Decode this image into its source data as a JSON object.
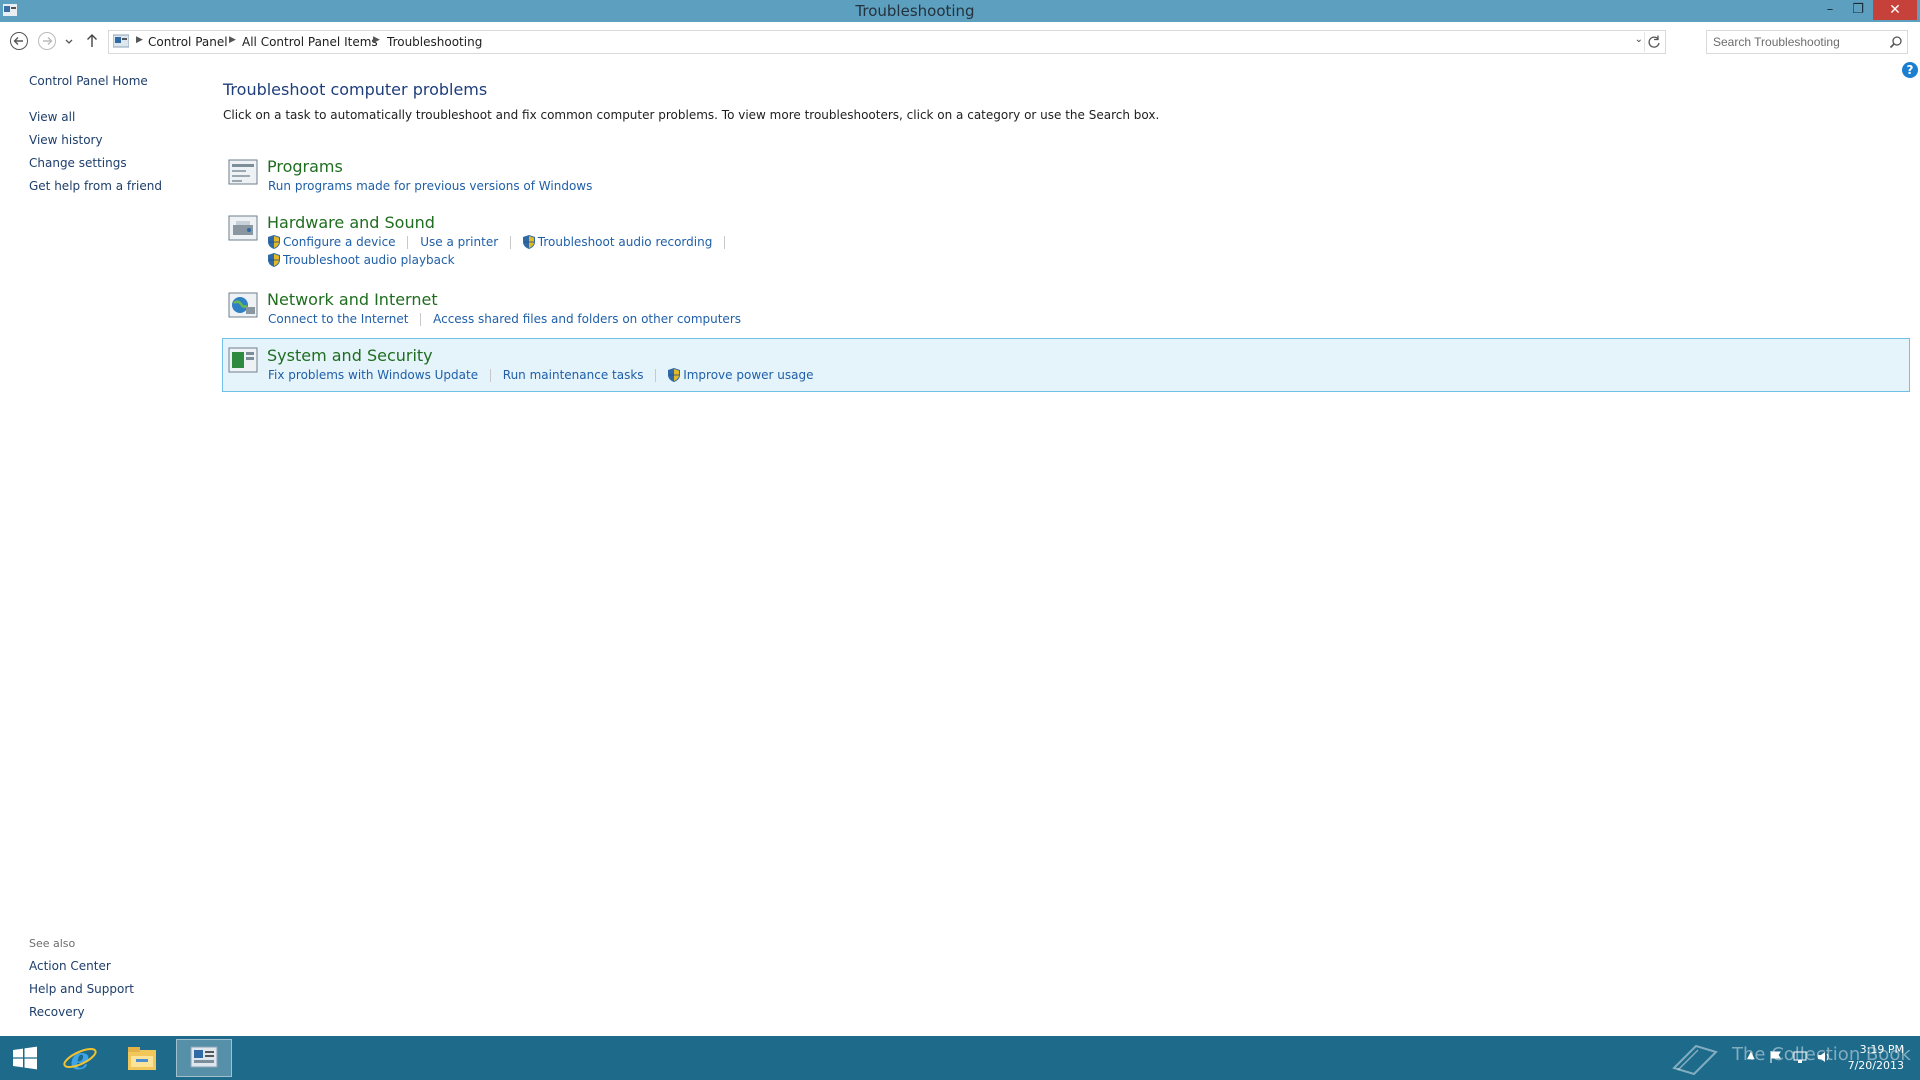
{
  "window": {
    "title": "Troubleshooting",
    "controls": {
      "minimize": "–",
      "restore": "❐",
      "close": "✕"
    }
  },
  "address_bar": {
    "breadcrumb": [
      "Control Panel",
      "All Control Panel Items",
      "Troubleshooting"
    ]
  },
  "search": {
    "placeholder": "Search Troubleshooting"
  },
  "sidebar": {
    "home": "Control Panel Home",
    "links": [
      "View all",
      "View history",
      "Change settings",
      "Get help from a friend"
    ],
    "see_also_label": "See also",
    "see_also": [
      "Action Center",
      "Help and Support",
      "Recovery"
    ]
  },
  "main": {
    "title": "Troubleshoot computer problems",
    "description": "Click on a task to automatically troubleshoot and fix common computer problems. To view more troubleshooters, click on a category or use the Search box.",
    "help_glyph": "?",
    "categories": [
      {
        "title": "Programs",
        "icon": "programs-icon",
        "tasks": [
          "Run programs made for previous versions of Windows"
        ]
      },
      {
        "title": "Hardware and Sound",
        "icon": "hardware-sound-icon",
        "tasks": [
          "Configure a device",
          "Use a printer",
          "Troubleshoot audio recording",
          "Troubleshoot audio playback"
        ]
      },
      {
        "title": "Network and Internet",
        "icon": "network-internet-icon",
        "tasks": [
          "Connect to the Internet",
          "Access shared files and folders on other computers"
        ]
      },
      {
        "title": "System and Security",
        "icon": "system-security-icon",
        "tasks": [
          "Fix problems with Windows Update",
          "Run maintenance tasks",
          "Improve power usage"
        ]
      }
    ]
  },
  "taskbar": {
    "watermark": "The Collection Book",
    "time": "3:19 PM",
    "date": "7/20/2013"
  },
  "colors": {
    "titlebar": "#5d9fbe",
    "taskbar": "#1d6a8b",
    "link": "#1f5fa8",
    "category_title": "#1f6d1f",
    "highlight": "#e5f3fb"
  }
}
